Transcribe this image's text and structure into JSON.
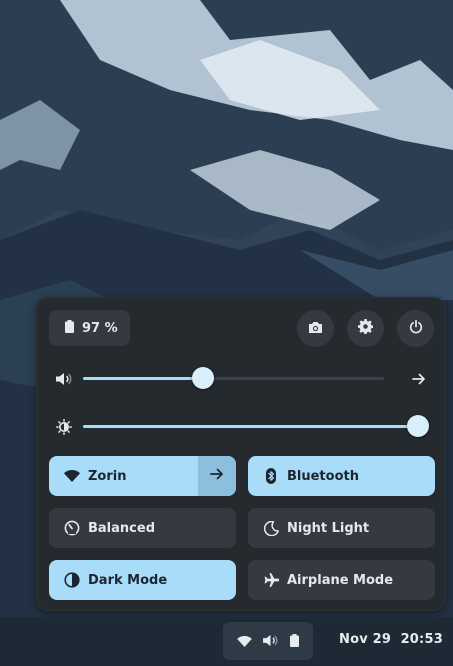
{
  "status": {
    "battery_label": "97 %"
  },
  "header_buttons": [
    {
      "icon": "screenshot-icon"
    },
    {
      "icon": "gear-icon"
    },
    {
      "icon": "power-icon"
    }
  ],
  "sliders": {
    "volume": {
      "icon": "speaker-icon",
      "level": 0.4
    },
    "brightness": {
      "icon": "brightness-icon",
      "level": 1.0
    }
  },
  "tiles": {
    "wifi": {
      "label": "Zorin",
      "icon": "wifi-icon",
      "active": true
    },
    "bluetooth": {
      "label": "Bluetooth",
      "icon": "bluetooth-icon",
      "active": true
    },
    "power_mode": {
      "label": "Balanced",
      "icon": "gauge-icon",
      "active": false
    },
    "night_light": {
      "label": "Night Light",
      "icon": "moon-icon",
      "active": false
    },
    "dark_mode": {
      "label": "Dark Mode",
      "icon": "contrast-icon",
      "active": true
    },
    "airplane": {
      "label": "Airplane Mode",
      "icon": "airplane-icon",
      "active": false
    }
  },
  "taskbar": {
    "tray_icons": [
      "wifi-icon",
      "speaker-icon",
      "battery-icon"
    ],
    "date": "Nov 29",
    "time": "20:53"
  },
  "colors": {
    "accent": "#a8dcf8",
    "panel": "#252a2f",
    "tile_inactive": "#343a40",
    "taskbar": "#1d2a36"
  }
}
